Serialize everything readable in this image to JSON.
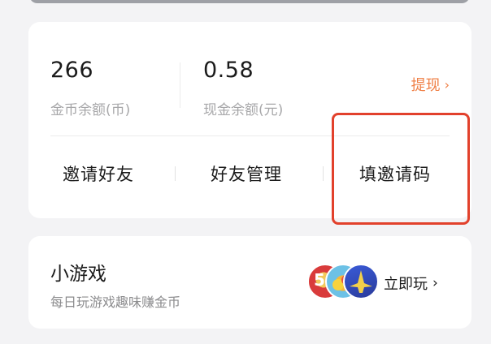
{
  "wallet": {
    "coins": {
      "value": "266",
      "label": "金币余额(币)"
    },
    "cash": {
      "value": "0.58",
      "label": "现金余额(元)"
    },
    "withdraw_label": "提现",
    "actions": [
      "邀请好友",
      "好友管理",
      "填邀请码"
    ]
  },
  "mini_game": {
    "title": "小游戏",
    "subtitle": "每日玩游戏趣味赚金币",
    "play_label": "立即玩",
    "badge_number": "5"
  },
  "colors": {
    "accent_orange": "#ef7f45",
    "highlight_red": "#e2412c",
    "card_bg": "#ffffff",
    "page_bg": "#f3f3f5"
  },
  "icons": {
    "chevron": "chevron-right-icon",
    "game_thumbnails": [
      "game-thumb-five-icon",
      "game-thumb-fruit-icon",
      "game-thumb-plane-icon"
    ]
  }
}
